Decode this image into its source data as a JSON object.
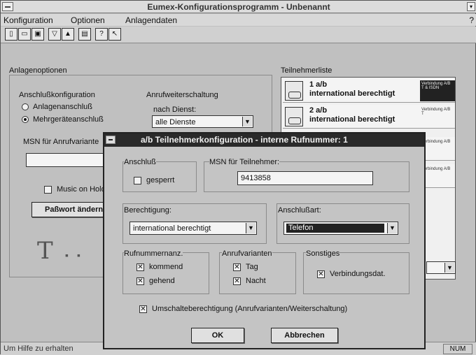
{
  "window": {
    "title": "Eumex-Konfigurationsprogramm - Unbenannt",
    "help_char": "?"
  },
  "menu": [
    "Konfiguration",
    "Optionen",
    "Anlagendaten"
  ],
  "toolbar": [
    "new",
    "open",
    "save",
    "filter",
    "up",
    "print",
    "help",
    "context-help"
  ],
  "main": {
    "anlagenoptionen": "Anlagenoptionen",
    "anschlusskonfiguration": "Anschlußkonfiguration",
    "radio_anlagen": "Anlagenanschluß",
    "radio_mehrgeraete": "Mehrgeräteanschluß",
    "rufweiter": "Anrufweiterschaltung",
    "nach_dienst": "nach Dienst:",
    "alle_dienste": "alle Dienste",
    "msn_anruf": "MSN für Anrufvariante",
    "music": "Music on Hold",
    "passwort": "Paßwort ändern"
  },
  "teilnehmerliste": {
    "title": "Teilnehmerliste",
    "items": [
      {
        "l1": "1 a/b",
        "l2": "international berechtigt",
        "badge": "Verbindung A/B T & ISDN"
      },
      {
        "l1": "2 a/b",
        "l2": "international berechtigt",
        "badge": "Verbindung A/B T"
      },
      {
        "l1": "",
        "l2": "",
        "badge": "Verbindung A/B"
      },
      {
        "l1": "",
        "l2": "",
        "badge": "Verbindung A/B"
      }
    ]
  },
  "dialog": {
    "title": "a/b Teilnehmerkonfiguration - interne Rufnummer: 1",
    "anschluss": "Anschluß",
    "gesperrt": "gesperrt",
    "msn_label": "MSN für Teilnehmer:",
    "msn_value": "9413858",
    "berechtigung": "Berechtigung:",
    "berechtigung_value": "international berechtigt",
    "anschlussart": "Anschlußart:",
    "anschlussart_value": "Telefon",
    "rufnummern": "Rufnummernanz.",
    "kommend": "kommend",
    "gehend": "gehend",
    "anrufvarianten": "Anrufvarianten",
    "tag": "Tag",
    "nacht": "Nacht",
    "sonstiges": "Sonstiges",
    "verbindungsdat": "Verbindungsdat.",
    "umschalte": "Umschalteberechtigung (Anrufvarianten/Weiterschaltung)",
    "ok": "OK",
    "abbrechen": "Abbrechen"
  },
  "status": {
    "help": "Um Hilfe zu erhalten",
    "num": "NUM"
  }
}
